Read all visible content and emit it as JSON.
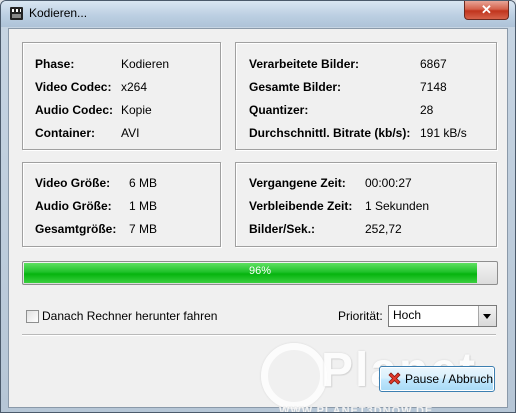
{
  "window": {
    "title": "Kodieren...",
    "close_symbol": "✕"
  },
  "info_box": {
    "rows": [
      {
        "label": "Phase:",
        "value": "Kodieren"
      },
      {
        "label": "Video Codec:",
        "value": "x264"
      },
      {
        "label": "Audio Codec:",
        "value": "Kopie"
      },
      {
        "label": "Container:",
        "value": "AVI"
      }
    ]
  },
  "stats_box": {
    "rows": [
      {
        "label": "Verarbeitete Bilder:",
        "value": "6867"
      },
      {
        "label": "Gesamte Bilder:",
        "value": "7148"
      },
      {
        "label": "Quantizer:",
        "value": "28"
      },
      {
        "label": "Durchschnittl. Bitrate (kb/s):",
        "value": "191 kB/s"
      }
    ]
  },
  "size_box": {
    "rows": [
      {
        "label": "Video Größe:",
        "value": "6 MB"
      },
      {
        "label": "Audio Größe:",
        "value": "1 MB"
      },
      {
        "label": "Gesamtgröße:",
        "value": "7 MB"
      }
    ]
  },
  "time_box": {
    "rows": [
      {
        "label": "Vergangene Zeit:",
        "value": "00:00:27"
      },
      {
        "label": "Verbleibende Zeit:",
        "value": "1 Sekunden"
      },
      {
        "label": "Bilder/Sek.:",
        "value": "252,72"
      }
    ]
  },
  "progress": {
    "percent": 96,
    "label": "96%",
    "color": "#16bd20"
  },
  "shutdown_checkbox": {
    "label": "Danach Rechner herunter fahren",
    "checked": false
  },
  "priority": {
    "label": "Priorität:",
    "value": "Hoch"
  },
  "pause_button": {
    "label": "Pause / Abbruch",
    "icon": "red-x-icon"
  },
  "watermark": {
    "big": "Planet",
    "small": "WWW.PLANET3DNOW.DE"
  },
  "colors": {
    "title_bar": "#bccfe2",
    "close_button": "#c0341d",
    "client_bg": "#f0f0f0"
  }
}
